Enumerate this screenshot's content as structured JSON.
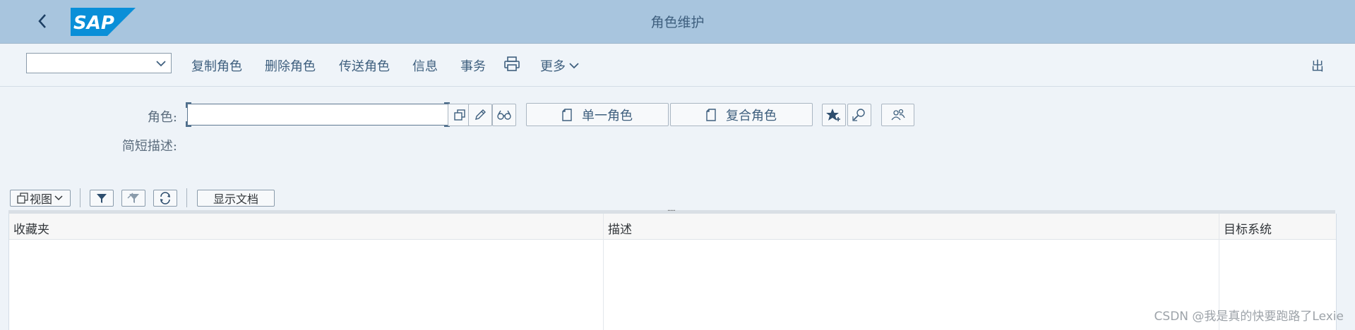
{
  "shell": {
    "title": "角色维护",
    "logo_text": "SAP",
    "brand_color": "#0a6ed1"
  },
  "toolbar": {
    "combo_value": "",
    "copy_role": "复制角色",
    "delete_role": "删除角色",
    "transport_role": "传送角色",
    "info": "信息",
    "transaction": "事务",
    "more": "更多",
    "exit": "出"
  },
  "form": {
    "role_label": "角色:",
    "role_value": "",
    "short_desc_label": "简短描述:",
    "single_role_btn": "单一角色",
    "composite_role_btn": "复合角色"
  },
  "alv_toolbar": {
    "view_btn": "视图",
    "show_doc_btn": "显示文档"
  },
  "table": {
    "columns": [
      "收藏夹",
      "描述",
      "目标系统"
    ]
  },
  "watermark": "CSDN @我是真的快要跑路了Lexie"
}
